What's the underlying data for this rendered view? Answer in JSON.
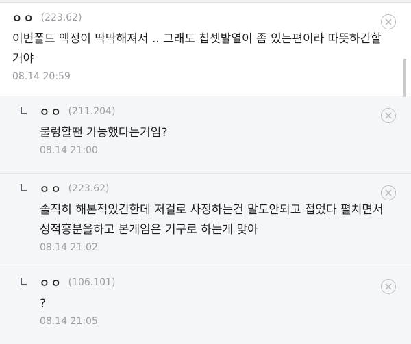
{
  "comments": [
    {
      "nick": "ㅇㅇ",
      "ip": "(223.62)",
      "text": "이번폴드 액정이 딱딱해져서 .. 그래도 칩셋발열이 좀 있는편이라 따뜻하긴할거야",
      "date": "08.14 20:59",
      "delete_icon": "close-circle-icon"
    },
    {
      "nick": "ㅇㅇ",
      "ip": "(211.204)",
      "text": "물렁할땐 가능했다는거임?",
      "date": "08.14 21:00",
      "delete_icon": "close-circle-icon"
    },
    {
      "nick": "ㅇㅇ",
      "ip": "(223.62)",
      "text": "솔직히 해본적있긴한데 저걸로 사정하는건 말도안되고 접었다 펼치면서 성적흥분을하고 본게임은 기구로 하는게 맞아",
      "date": "08.14 21:02",
      "delete_icon": "close-circle-icon"
    },
    {
      "nick": "ㅇㅇ",
      "ip": "(106.101)",
      "text": "?",
      "date": "08.14 21:05",
      "delete_icon": "close-circle-icon"
    }
  ]
}
